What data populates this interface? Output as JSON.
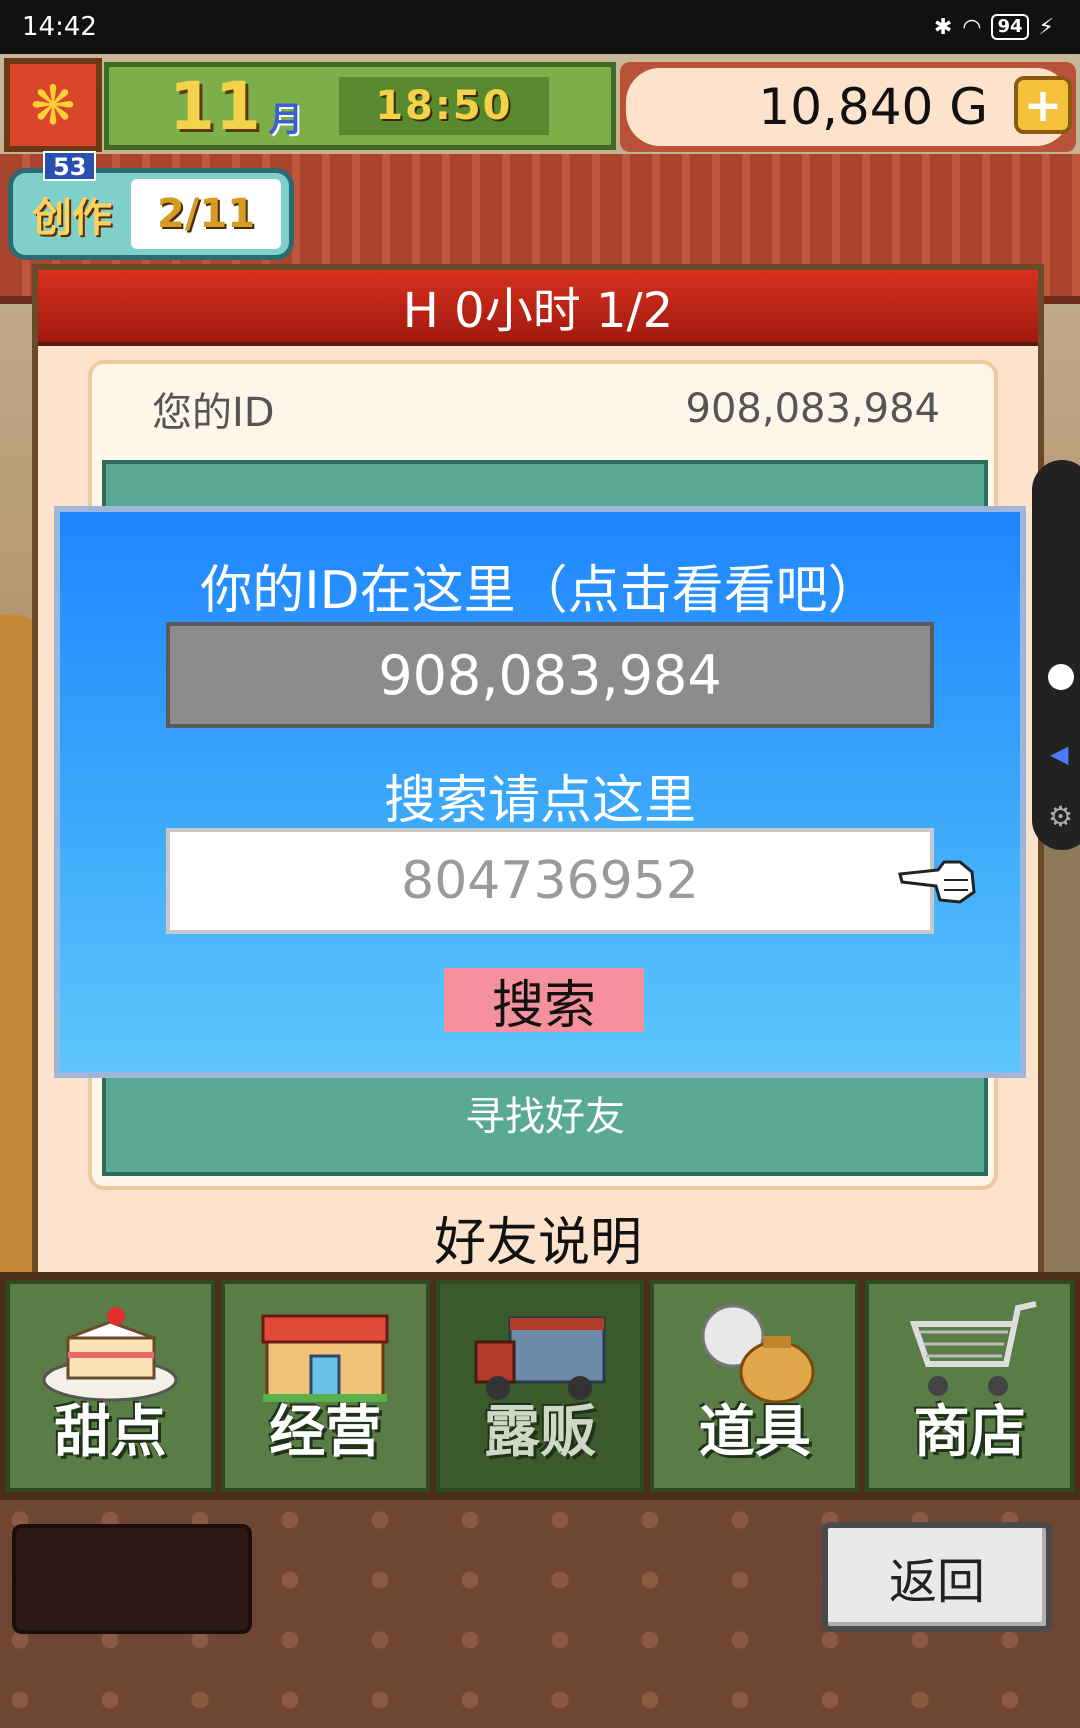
{
  "status_bar": {
    "time": "14:42",
    "battery": "94"
  },
  "hud": {
    "month_number": "11",
    "month_label": "月",
    "clock": "18:50",
    "money": "10,840 G",
    "add_symbol": "+"
  },
  "creation": {
    "label": "创作",
    "level": "53",
    "progress": "2/11"
  },
  "dialog": {
    "header": "H  0小时 1/2",
    "id_label": "您的ID",
    "id_value": "908,083,984",
    "panel_title": "寻找好友",
    "help_label": "好友说明"
  },
  "popup": {
    "title": "你的ID在这里（点击看看吧）",
    "my_id": "908,083,984",
    "search_label": "搜索请点这里",
    "search_placeholder": "804736952",
    "search_button": "搜索"
  },
  "nav": {
    "tabs": [
      {
        "label": "甜点",
        "icon": "cake-icon"
      },
      {
        "label": "经营",
        "icon": "shop-building-icon"
      },
      {
        "label": "露贩",
        "icon": "food-truck-icon"
      },
      {
        "label": "道具",
        "icon": "items-bag-icon"
      },
      {
        "label": "商店",
        "icon": "shopping-cart-icon"
      }
    ],
    "active_index": 2
  },
  "footer": {
    "back_label": "返回"
  },
  "colors": {
    "popup_top": "#1f86ff",
    "popup_bottom": "#5ec6fb",
    "header_red": "#c0241a",
    "teal_panel": "#5aa995",
    "search_button": "#f5919c"
  }
}
